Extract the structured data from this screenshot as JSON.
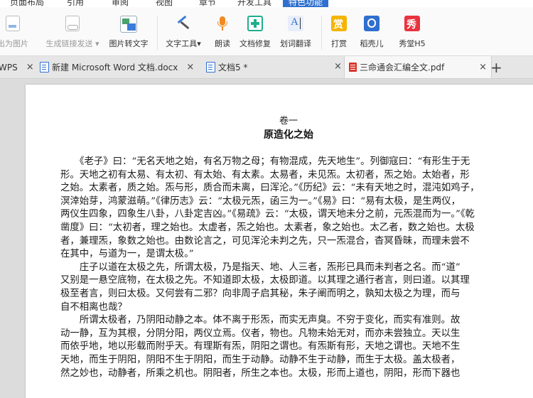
{
  "menu_tabs": [
    "页面布局",
    "引用",
    "审阅",
    "视图",
    "章节",
    "开发工具",
    "特色功能"
  ],
  "active_menu_tab": "特色功能",
  "ribbon": {
    "export_image": "出为图片",
    "gen_link": "生成链接发送",
    "gen_link_arrow": "▾",
    "img_to_text": "图片转文字",
    "text_tools": "文字工具",
    "text_tools_arrow": "▾",
    "read_aloud": "朗读",
    "doc_repair": "文档修复",
    "word_translate": "划词翻译",
    "reward": "打赏",
    "shell": "稻壳儿",
    "xiutang": "秀堂H5",
    "reward_glyph": "赏",
    "xiutang_glyph": "秀",
    "translate_glyph": "A"
  },
  "doc_tabs": [
    {
      "label": "WPS",
      "close": "×"
    },
    {
      "label": "新建 Microsoft Word 文档.docx",
      "close": "×"
    },
    {
      "label": "文档5 *",
      "close": ""
    },
    {
      "label": "三命通会汇编全文.pdf",
      "close": "×"
    }
  ],
  "add_tab": "+",
  "document": {
    "volume": "卷一",
    "chapter_title": "原造化之始",
    "lines": [
      "　　《老子》曰：“无名天地之始，有名万物之母；有物混成，先天地生”。列御寇曰：“有形生于无",
      "形。天地之初有太易、有太初、有太始、有太素。太易者，未见炁。太初者，炁之始。太始者，形",
      "之始。太素者，质之始。炁与形，质合而未离，曰浑沦。”《历纪》云：“未有天地之时，混沌如鸡子，",
      "溟涬始芽，鸿蒙滋萌。”《律历志》云：“太极元炁，函三为一。”《易》曰：“易有太极，是生两仪，",
      "两仪生四象，四象生八卦，八卦定吉凶。”《易疏》云：“太极，谓天地未分之前，元炁混而为一。”《乾",
      "凿度》曰：“太初者，理之始也。太虚者，炁之始也。太素者，象之始也。太乙者，数之始也。太极",
      "者，兼理炁，象数之始也。由数论言之，可见浑沦未判之先，只一炁混合，杳冥昏昧，而理未尝不",
      "在其中，与道为一，是谓太极。”",
      "　　庄子以道在太极之先，所谓太极，乃是指天、地、人三者，炁形已具而未判者之名。而“道”",
      "又别是一悬空底物，在太极之先。不知道即太极，太极即道。以其理之通行者言，则曰道。以其理",
      "极至者言，则曰太极。又何尝有二邪？向非周子启其秘，朱子阐而明之，孰知太极之为理，而与",
      "自不相离也哉？",
      "　　所谓太极者，乃阴阳动静之本。体不离于形炁，而实无声臭。不穷于变化，而实有准则。故",
      "动一静，互为其根，分阴分阳，两仪立焉。仪者，物也。凡物未始无对，而亦未尝独立。天以生",
      "而依乎地，地以形载而附乎天。有理斯有炁，阴阳之谓也。有炁斯有形，天地之谓也。天地不生",
      "天地，而生于阴阳，阴阳不生于阴阳，而生于动静。动静不生于动静，而生于太极。盖太极者，",
      "然之妙也，动静者，所乘之机也。阴阳者，所生之本也。太极，形而上道也，阴阳，形而下器也"
    ]
  }
}
